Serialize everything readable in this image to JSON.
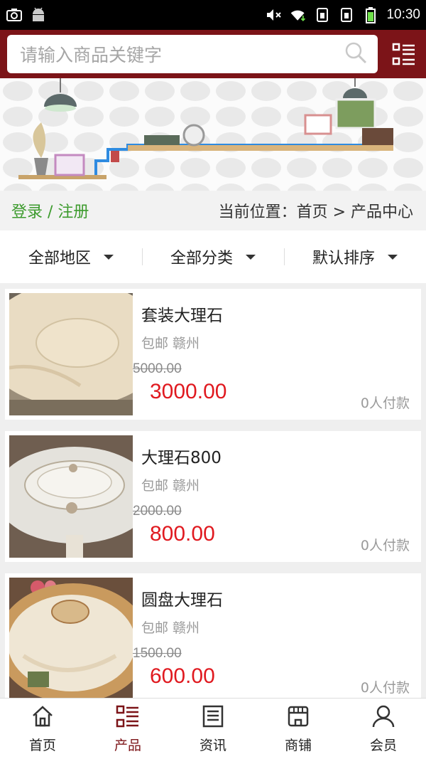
{
  "status_bar": {
    "time": "10:30",
    "left_icons": [
      "screenshot-icon",
      "android-icon"
    ],
    "right_icons": [
      "mute-icon",
      "wifi-icon",
      "sim1-icon",
      "sim2-icon",
      "battery-icon"
    ]
  },
  "header": {
    "search_placeholder": "请输入商品关键字",
    "search_icon": "search-icon",
    "menu_icon": "category-menu-icon",
    "color": "#7c1418"
  },
  "location": {
    "login_label": "登录 / 注册",
    "crumb": "当前位置：首页 > 产品中心"
  },
  "filters": [
    {
      "label": "全部地区"
    },
    {
      "label": "全部分类"
    },
    {
      "label": "默认排序"
    }
  ],
  "products": [
    {
      "title": "套装大理石",
      "meta": "包邮 赣州",
      "old_price": "5000.00",
      "price": "3000.00",
      "sold": "0人付款"
    },
    {
      "title": "大理石800",
      "meta": "包邮 赣州",
      "old_price": "2000.00",
      "price": "800.00",
      "sold": "0人付款"
    },
    {
      "title": "圆盘大理石",
      "meta": "包邮 赣州",
      "old_price": "1500.00",
      "price": "600.00",
      "sold": "0人付款"
    }
  ],
  "tabbar": [
    {
      "label": "首页",
      "icon": "home-icon"
    },
    {
      "label": "产品",
      "icon": "product-grid-icon",
      "active": true
    },
    {
      "label": "资讯",
      "icon": "news-icon"
    },
    {
      "label": "商铺",
      "icon": "store-icon"
    },
    {
      "label": "会员",
      "icon": "user-icon"
    }
  ],
  "colors": {
    "accent": "#7c1418",
    "price": "#e0191f",
    "login": "#3c9b2d"
  }
}
